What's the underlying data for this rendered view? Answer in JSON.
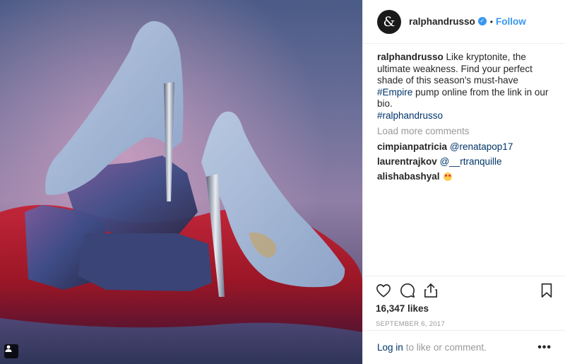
{
  "post": {
    "image_alt": "Two light blue suede stiletto pumps with metallic heels posed on dark rocks over red sand",
    "account": {
      "avatar_glyph": "&",
      "username": "ralphandrusso",
      "verified": true,
      "separator": "•",
      "follow_label": "Follow"
    },
    "caption": {
      "username": "ralphandrusso",
      "text_1": "Like kryptonite, the ultimate weakness. Find your perfect shade of this season's must-have",
      "hashtag_1": "#Empire",
      "text_2": "pump online from the link in our bio.",
      "hashtag_2": "#ralphandrusso"
    },
    "load_more_label": "Load more comments",
    "comments": [
      {
        "username": "cimpianpatricia",
        "text": "@renatapop17"
      },
      {
        "username": "laurentrajkov",
        "text": "@__rtranquille"
      },
      {
        "username": "alishabashyal",
        "text": "",
        "emoji": "heart-eyes-emoji"
      }
    ],
    "likes_label": "16,347 likes",
    "date_label": "SEPTEMBER 6, 2017",
    "footer": {
      "login_label": "Log in",
      "rest_label": "to like or comment.",
      "more_label": "•••"
    },
    "icons": [
      "heart-icon",
      "comment-icon",
      "share-icon",
      "bookmark-icon",
      "user-tag-icon"
    ],
    "colors": {
      "accent": "#3897f0",
      "link": "#003569",
      "muted": "#999999",
      "text": "#262626",
      "divider": "#efefef"
    }
  }
}
